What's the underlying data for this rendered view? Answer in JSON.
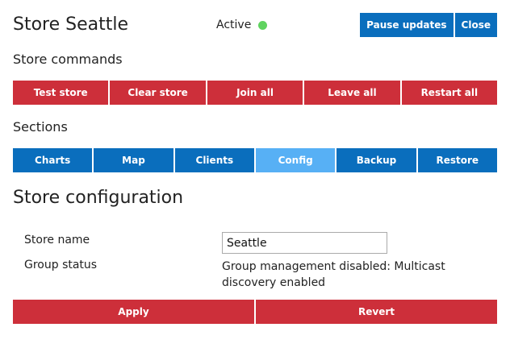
{
  "header": {
    "title": "Store Seattle",
    "status_label": "Active",
    "status_color": "#5fd35f",
    "pause_label": "Pause updates",
    "close_label": "Close"
  },
  "commands": {
    "heading": "Store commands",
    "buttons": [
      "Test store",
      "Clear store",
      "Join all",
      "Leave all",
      "Restart all"
    ]
  },
  "sections": {
    "heading": "Sections",
    "tabs": [
      "Charts",
      "Map",
      "Clients",
      "Config",
      "Backup",
      "Restore"
    ],
    "active_tab": "Config"
  },
  "config": {
    "heading": "Store configuration",
    "store_name_label": "Store name",
    "store_name_value": "Seattle",
    "group_status_label": "Group status",
    "group_status_value": "Group management disabled: Multicast discovery enabled",
    "apply_label": "Apply",
    "revert_label": "Revert"
  },
  "colors": {
    "red": "#cd2f3a",
    "blue": "#0a6ebd",
    "active_tab": "#57b0f5"
  }
}
